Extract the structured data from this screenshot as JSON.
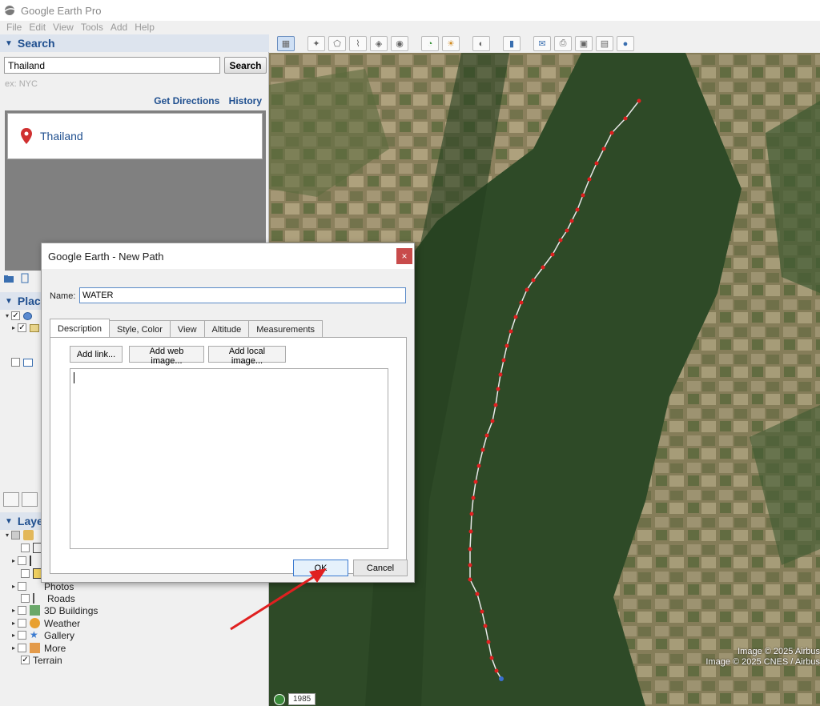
{
  "app": {
    "title": "Google Earth Pro"
  },
  "menu": [
    "File",
    "Edit",
    "View",
    "Tools",
    "Add",
    "Help"
  ],
  "search": {
    "header": "Search",
    "query": "Thailand",
    "button": "Search",
    "hint": "ex: NYC",
    "get_directions": "Get Directions",
    "history": "History",
    "result": "Thailand"
  },
  "places": {
    "header": "Places"
  },
  "layers": {
    "header": "Layers",
    "items": [
      {
        "label": "Photos",
        "checked": false
      },
      {
        "label": "Roads",
        "checked": false
      },
      {
        "label": "3D Buildings",
        "checked": false
      },
      {
        "label": "Weather",
        "checked": false
      },
      {
        "label": "Gallery",
        "checked": false
      },
      {
        "label": "More",
        "checked": false
      },
      {
        "label": "Terrain",
        "checked": true
      }
    ]
  },
  "map": {
    "attribution_1": "Image © 2025 Airbus",
    "attribution_2": "Image © 2025 CNES / Airbus",
    "year": "1985"
  },
  "dialog": {
    "title": "Google Earth - New Path",
    "close": "×",
    "name_label": "Name:",
    "name_value": "WATER",
    "tabs": [
      "Description",
      "Style, Color",
      "View",
      "Altitude",
      "Measurements"
    ],
    "active_tab": "Description",
    "add_link": "Add link...",
    "add_web_image": "Add web image...",
    "add_local_image": "Add local image...",
    "ok": "OK",
    "cancel": "Cancel"
  },
  "colors": {
    "path_line": "#e8e8e8",
    "path_point": "#e02020",
    "arrow": "#e02020",
    "header_text": "#1f4f8f"
  }
}
